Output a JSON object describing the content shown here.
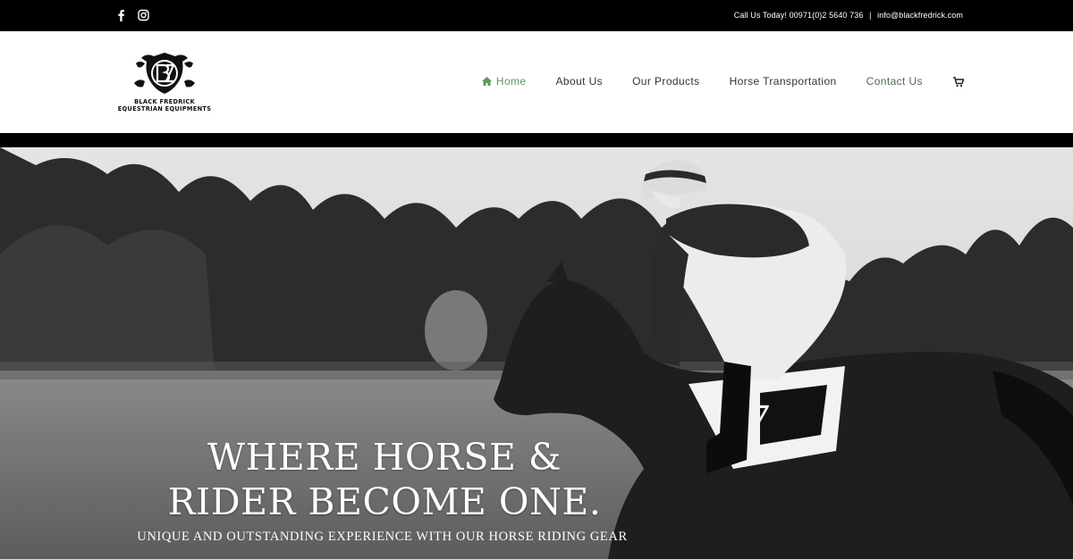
{
  "topbar": {
    "social": [
      {
        "name": "facebook-icon",
        "glyph": "f"
      },
      {
        "name": "instagram-icon",
        "glyph": ""
      }
    ],
    "call_text": "Call Us Today! 00971(0)2 5640 736",
    "separator": "|",
    "email": "info@blackfredrick.com"
  },
  "logo": {
    "line1": "BLACK FREDRICK",
    "line2": "EQUESTRIAN EQUIPMENTS"
  },
  "nav": {
    "items": [
      {
        "label": "Home",
        "active": true,
        "icon": "home-icon"
      },
      {
        "label": "About Us"
      },
      {
        "label": "Our Products"
      },
      {
        "label": "Horse Transportation"
      },
      {
        "label": "Contact Us"
      }
    ],
    "cart_icon": "cart-icon"
  },
  "hero": {
    "title_line1": "WHERE HORSE &",
    "title_line2": "RIDER BECOME ONE.",
    "subtitle": "UNIQUE AND OUTSTANDING EXPERIENCE WITH OUR HORSE RIDING GEAR",
    "saddle_number": "7"
  },
  "colors": {
    "topbar_bg": "#000000",
    "nav_active": "#5b9a5b",
    "nav_text": "#333333"
  }
}
